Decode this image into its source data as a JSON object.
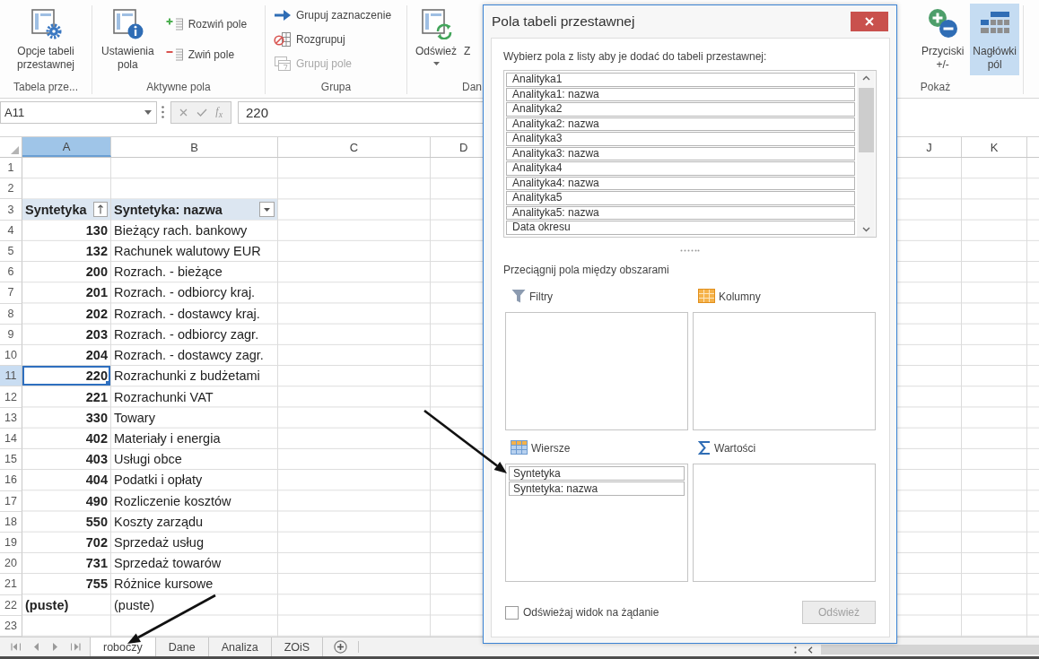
{
  "ribbon": {
    "groups": [
      {
        "label": "Tabela prze...",
        "items": [
          {
            "kind": "large",
            "label": "Opcje tabeli\nprzestawnej"
          }
        ]
      },
      {
        "label": "Aktywne pola",
        "items": [
          {
            "kind": "large",
            "label": "Ustawienia\npola"
          },
          {
            "kind": "small",
            "label": "Rozwiń pole",
            "disabled": false
          },
          {
            "kind": "small",
            "label": "Zwiń pole",
            "disabled": false
          }
        ]
      },
      {
        "label": "Grupa",
        "items": [
          {
            "kind": "small",
            "label": "Grupuj zaznaczenie",
            "disabled": false
          },
          {
            "kind": "small",
            "label": "Rozgrupuj",
            "disabled": false
          },
          {
            "kind": "small",
            "label": "Grupuj pole",
            "disabled": true
          }
        ]
      },
      {
        "label": "Dan",
        "items": [
          {
            "kind": "large",
            "label": "Odśwież",
            "dropdown": true
          },
          {
            "kind": "large",
            "label": "Z"
          }
        ]
      },
      {
        "label": "Pokaż",
        "items": [
          {
            "kind": "large",
            "label": "Przyciski\n+/-",
            "on": false
          },
          {
            "kind": "large",
            "label": "Nagłówki\npól",
            "on": true
          }
        ]
      }
    ]
  },
  "formula_bar": {
    "name_box": "A11",
    "function_label": "f$_{x}$",
    "value": "220"
  },
  "sheet": {
    "columns": [
      {
        "label": "A",
        "selected": true
      },
      {
        "label": "B",
        "selected": false
      },
      {
        "label": "C",
        "selected": false
      },
      {
        "label": "D",
        "selected": false
      },
      {
        "label": "J",
        "selected": false
      },
      {
        "label": "K",
        "selected": false
      }
    ],
    "rows": [
      {
        "number": "1",
        "selected": false
      },
      {
        "number": "2",
        "selected": false
      },
      {
        "number": "3",
        "selected": false,
        "cells": [
          {
            "kind": "sort-header",
            "text": "Syntetyka",
            "active": false
          },
          {
            "kind": "filter-header",
            "text": "Syntetyka: nazwa",
            "active": false
          }
        ]
      },
      {
        "number": "4",
        "selected": false,
        "cells": [
          {
            "kind": "number",
            "text": "130",
            "active": false
          },
          {
            "kind": "text",
            "text": "Bieżący rach. bankowy",
            "active": false
          }
        ]
      },
      {
        "number": "5",
        "selected": false,
        "cells": [
          {
            "kind": "number",
            "text": "132",
            "active": false
          },
          {
            "kind": "text",
            "text": "Rachunek walutowy EUR",
            "active": false
          }
        ]
      },
      {
        "number": "6",
        "selected": false,
        "cells": [
          {
            "kind": "number",
            "text": "200",
            "active": false
          },
          {
            "kind": "text",
            "text": "Rozrach. - bieżące",
            "active": false
          }
        ]
      },
      {
        "number": "7",
        "selected": false,
        "cells": [
          {
            "kind": "number",
            "text": "201",
            "active": false
          },
          {
            "kind": "text",
            "text": "Rozrach. - odbiorcy kraj.",
            "active": false
          }
        ]
      },
      {
        "number": "8",
        "selected": false,
        "cells": [
          {
            "kind": "number",
            "text": "202",
            "active": false
          },
          {
            "kind": "text",
            "text": "Rozrach. - dostawcy kraj.",
            "active": false
          }
        ]
      },
      {
        "number": "9",
        "selected": false,
        "cells": [
          {
            "kind": "number",
            "text": "203",
            "active": false
          },
          {
            "kind": "text",
            "text": "Rozrach. - odbiorcy zagr.",
            "active": false
          }
        ]
      },
      {
        "number": "10",
        "selected": false,
        "cells": [
          {
            "kind": "number",
            "text": "204",
            "active": false
          },
          {
            "kind": "text",
            "text": "Rozrach. - dostawcy zagr.",
            "active": false
          }
        ]
      },
      {
        "number": "11",
        "selected": true,
        "cells": [
          {
            "kind": "number",
            "text": "220",
            "active": true
          },
          {
            "kind": "text",
            "text": "Rozrachunki z budżetami",
            "active": false
          }
        ]
      },
      {
        "number": "12",
        "selected": false,
        "cells": [
          {
            "kind": "number",
            "text": "221",
            "active": false
          },
          {
            "kind": "text",
            "text": "Rozrachunki VAT",
            "active": false
          }
        ]
      },
      {
        "number": "13",
        "selected": false,
        "cells": [
          {
            "kind": "number",
            "text": "330",
            "active": false
          },
          {
            "kind": "text",
            "text": "Towary",
            "active": false
          }
        ]
      },
      {
        "number": "14",
        "selected": false,
        "cells": [
          {
            "kind": "number",
            "text": "402",
            "active": false
          },
          {
            "kind": "text",
            "text": "Materiały i energia",
            "active": false
          }
        ]
      },
      {
        "number": "15",
        "selected": false,
        "cells": [
          {
            "kind": "number",
            "text": "403",
            "active": false
          },
          {
            "kind": "text",
            "text": "Usługi obce",
            "active": false
          }
        ]
      },
      {
        "number": "16",
        "selected": false,
        "cells": [
          {
            "kind": "number",
            "text": "404",
            "active": false
          },
          {
            "kind": "text",
            "text": "Podatki i opłaty",
            "active": false
          }
        ]
      },
      {
        "number": "17",
        "selected": false,
        "cells": [
          {
            "kind": "number",
            "text": "490",
            "active": false
          },
          {
            "kind": "text",
            "text": "Rozliczenie kosztów",
            "active": false
          }
        ]
      },
      {
        "number": "18",
        "selected": false,
        "cells": [
          {
            "kind": "number",
            "text": "550",
            "active": false
          },
          {
            "kind": "text",
            "text": "Koszty zarządu",
            "active": false
          }
        ]
      },
      {
        "number": "19",
        "selected": false,
        "cells": [
          {
            "kind": "number",
            "text": "702",
            "active": false
          },
          {
            "kind": "text",
            "text": "Sprzedaż usług",
            "active": false
          }
        ]
      },
      {
        "number": "20",
        "selected": false,
        "cells": [
          {
            "kind": "number",
            "text": "731",
            "active": false
          },
          {
            "kind": "text",
            "text": "Sprzedaż towarów",
            "active": false
          }
        ]
      },
      {
        "number": "21",
        "selected": false,
        "cells": [
          {
            "kind": "number",
            "text": "755",
            "active": false
          },
          {
            "kind": "text",
            "text": "Różnice kursowe",
            "active": false
          }
        ]
      },
      {
        "number": "22",
        "selected": false,
        "cells": [
          {
            "kind": "label",
            "text": "(puste)",
            "active": false
          },
          {
            "kind": "text",
            "text": "(puste)",
            "active": false
          }
        ]
      },
      {
        "number": "23",
        "selected": false
      }
    ]
  },
  "sheet_tabs": [
    {
      "label": "roboczy",
      "selected": true
    },
    {
      "label": "Dane",
      "selected": false
    },
    {
      "label": "Analiza",
      "selected": false
    },
    {
      "label": "ZOiS",
      "selected": false
    }
  ],
  "dialog": {
    "title": "Pola tabeli przestawnej",
    "prompt": "Wybierz pola z listy aby je dodać do tabeli przestawnej:",
    "fields": [
      "Analityka1",
      "Analityka1: nazwa",
      "Analityka2",
      "Analityka2: nazwa",
      "Analityka3",
      "Analityka3: nazwa",
      "Analityka4",
      "Analityka4: nazwa",
      "Analityka5",
      "Analityka5: nazwa",
      "Data okresu"
    ],
    "areas_prompt": "Przeciągnij pola między obszarami",
    "areas": [
      {
        "label": "Filtry"
      },
      {
        "label": "Kolumny"
      },
      {
        "label": "Wiersze",
        "fields": [
          "Syntetyka",
          "Syntetyka: nazwa"
        ]
      },
      {
        "label": "Wartości"
      }
    ],
    "defer_update": {
      "label": "Odświeżaj widok na żądanie",
      "checked": false
    },
    "update_button": {
      "label": "Odśwież",
      "disabled": true
    }
  }
}
